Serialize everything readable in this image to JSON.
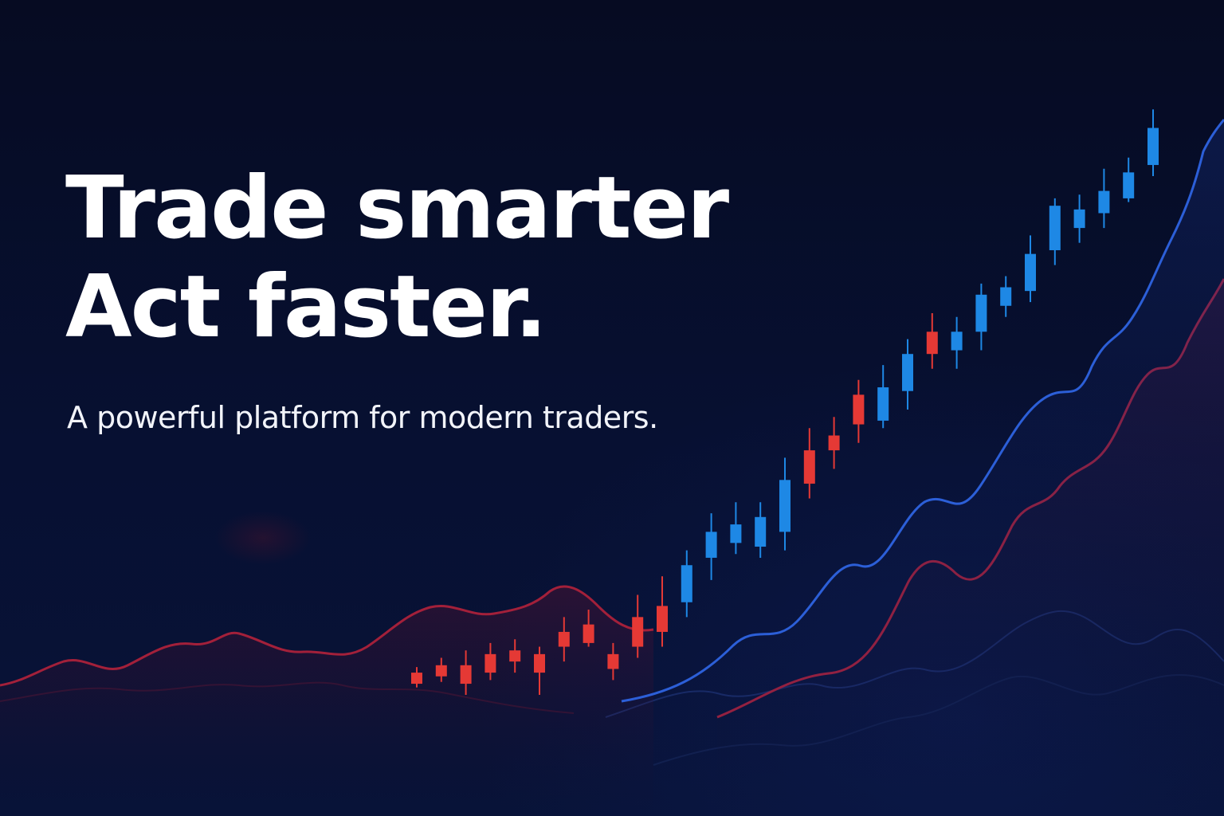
{
  "hero": {
    "headline_line1": "Trade smarter",
    "headline_line2": "Act faster.",
    "tagline": "A powerful platform for modern traders."
  },
  "colors": {
    "background": "#050b25",
    "bullish": "#1e88e5",
    "bearish": "#e53935",
    "line_blue": "#2f5fd6",
    "line_red": "#b3243c"
  },
  "candles": [
    {
      "trend": "down",
      "open": 14.0,
      "close": 11.0,
      "high": 15.5,
      "low": 10.0
    },
    {
      "trend": "down",
      "open": 16.0,
      "close": 13.0,
      "high": 18.0,
      "low": 11.5
    },
    {
      "trend": "down",
      "open": 16.0,
      "close": 11.0,
      "high": 20.0,
      "low": 8.0
    },
    {
      "trend": "down",
      "open": 19.0,
      "close": 14.0,
      "high": 22.0,
      "low": 12.0
    },
    {
      "trend": "down",
      "open": 20.0,
      "close": 17.0,
      "high": 23.0,
      "low": 14.0
    },
    {
      "trend": "down",
      "open": 19.0,
      "close": 14.0,
      "high": 21.0,
      "low": 8.0
    },
    {
      "trend": "down",
      "open": 25.0,
      "close": 21.0,
      "high": 29.0,
      "low": 17.0
    },
    {
      "trend": "down",
      "open": 27.0,
      "close": 22.0,
      "high": 31.0,
      "low": 21.0
    },
    {
      "trend": "down",
      "open": 19.0,
      "close": 15.0,
      "high": 22.0,
      "low": 12.0
    },
    {
      "trend": "down",
      "open": 29.0,
      "close": 21.0,
      "high": 35.0,
      "low": 18.0
    },
    {
      "trend": "down",
      "open": 32.0,
      "close": 25.0,
      "high": 40.0,
      "low": 21.0
    },
    {
      "trend": "up",
      "open": 33.0,
      "close": 43.0,
      "high": 47.0,
      "low": 29.0
    },
    {
      "trend": "up",
      "open": 45.0,
      "close": 52.0,
      "high": 57.0,
      "low": 39.0
    },
    {
      "trend": "up",
      "open": 49.0,
      "close": 54.0,
      "high": 60.0,
      "low": 46.0
    },
    {
      "trend": "up",
      "open": 48.0,
      "close": 56.0,
      "high": 60.0,
      "low": 45.0
    },
    {
      "trend": "up",
      "open": 52.0,
      "close": 66.0,
      "high": 72.0,
      "low": 47.0
    },
    {
      "trend": "down",
      "open": 74.0,
      "close": 65.0,
      "high": 80.0,
      "low": 61.0
    },
    {
      "trend": "down",
      "open": 78.0,
      "close": 74.0,
      "high": 83.0,
      "low": 69.0
    },
    {
      "trend": "down",
      "open": 89.0,
      "close": 81.0,
      "high": 93.0,
      "low": 76.0
    },
    {
      "trend": "up",
      "open": 82.0,
      "close": 91.0,
      "high": 97.0,
      "low": 80.0
    },
    {
      "trend": "up",
      "open": 90.0,
      "close": 100.0,
      "high": 104.0,
      "low": 85.0
    },
    {
      "trend": "down",
      "open": 106.0,
      "close": 100.0,
      "high": 111.0,
      "low": 96.0
    },
    {
      "trend": "up",
      "open": 101.0,
      "close": 106.0,
      "high": 110.0,
      "low": 96.0
    },
    {
      "trend": "up",
      "open": 106.0,
      "close": 116.0,
      "high": 119.0,
      "low": 101.0
    },
    {
      "trend": "up",
      "open": 113.0,
      "close": 118.0,
      "high": 121.0,
      "low": 110.0
    },
    {
      "trend": "up",
      "open": 117.0,
      "close": 127.0,
      "high": 132.0,
      "low": 114.0
    },
    {
      "trend": "up",
      "open": 128.0,
      "close": 140.0,
      "high": 142.0,
      "low": 124.0
    },
    {
      "trend": "up",
      "open": 134.0,
      "close": 139.0,
      "high": 143.0,
      "low": 130.0
    },
    {
      "trend": "up",
      "open": 138.0,
      "close": 144.0,
      "high": 150.0,
      "low": 134.0
    },
    {
      "trend": "up",
      "open": 142.0,
      "close": 149.0,
      "high": 153.0,
      "low": 141.0
    },
    {
      "trend": "up",
      "open": 151.0,
      "close": 161.0,
      "high": 166.0,
      "low": 148.0
    }
  ]
}
